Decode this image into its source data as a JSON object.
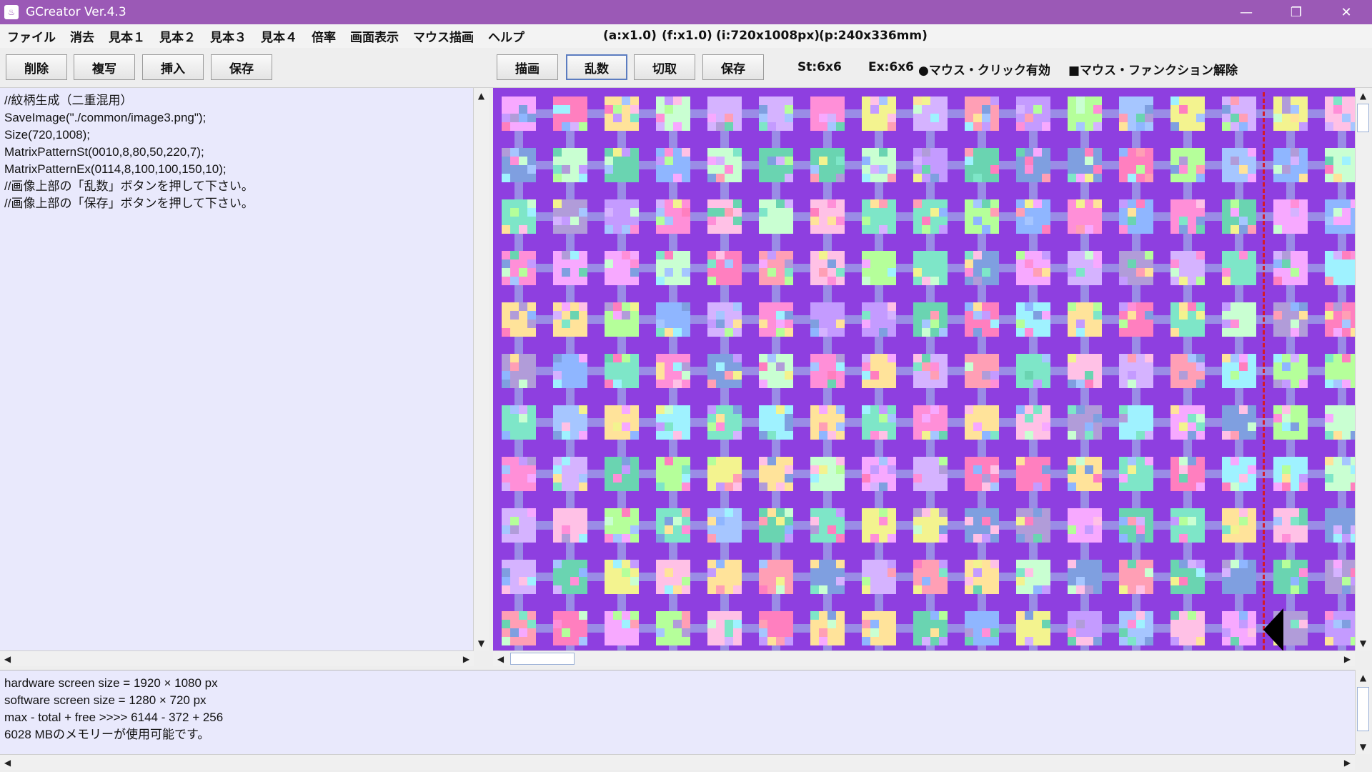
{
  "window": {
    "title": "GCreator  Ver.4.3",
    "accent": "#9b59b6"
  },
  "menubar": {
    "items": [
      "ファイル",
      "消去",
      "見本１",
      "見本２",
      "見本３",
      "見本４",
      "倍率",
      "画面表示",
      "マウス描画",
      "ヘルプ"
    ],
    "status": [
      "(a:x1.0)",
      "(f:x1.0)",
      "(i:720x1008px)",
      "(p:240x336mm)"
    ]
  },
  "toolbar": {
    "left_buttons": [
      "削除",
      "複写",
      "挿入",
      "保存"
    ],
    "right_buttons": [
      "描画",
      "乱数",
      "切取",
      "保存"
    ],
    "st_label": "St:6x6",
    "ex_label": "Ex:6x6",
    "mouse_click_label": "●マウス・クリック有効",
    "mouse_function_label": "■マウス・ファンクション解除"
  },
  "editor": {
    "lines": [
      "//紋柄生成（二重混用）",
      "SaveImage(\"./common/image3.png\");",
      "Size(720,1008);",
      "MatrixPatternSt(0010,8,80,50,220,7);",
      "MatrixPatternEx(0114,8,100,100,150,10);",
      "//画像上部の「乱数」ボタンを押して下さい。",
      "//画像上部の「保存」ボタンを押して下さい。"
    ]
  },
  "console": {
    "lines": [
      "hardware screen size = 1920 × 1080 px",
      "software screen size = 1280 × 720 px",
      "max - total + free >>>> 6144 - 372 + 256",
      "6028 MBのメモリーが使用可能です。"
    ]
  },
  "canvas": {
    "background_color": "#8e3fe0",
    "grid_color": "#9a8ce6",
    "palette": [
      "#ff8fd8",
      "#7ee6c8",
      "#f3f38f",
      "#8fb6ff",
      "#c49bff",
      "#ff9fb5",
      "#9ff2ff",
      "#b5ff9a",
      "#d5b3ff",
      "#ffc1e6",
      "#6ad4b1",
      "#f7a9ff",
      "#a6c6ff",
      "#ffe39a",
      "#7f9fe0",
      "#ff7fbf",
      "#c9ffd2",
      "#b19cd9"
    ]
  }
}
